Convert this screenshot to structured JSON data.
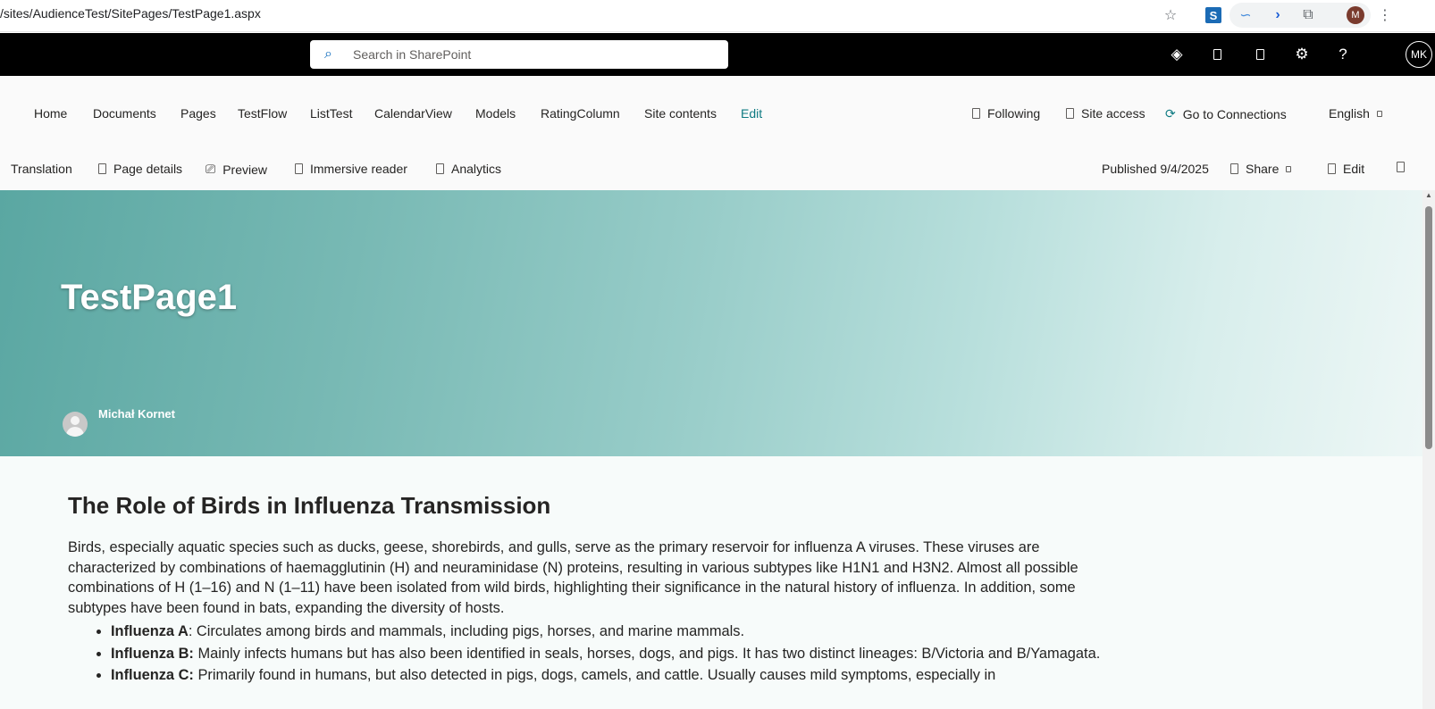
{
  "browser": {
    "url": "/sites/AudienceTest/SitePages/TestPage1.aspx",
    "profile_initial": "M",
    "extension_s": "S"
  },
  "suite": {
    "search_placeholder": "Search in SharePoint",
    "user_initials": "MK"
  },
  "site_nav": {
    "items": [
      "Home",
      "Documents",
      "Pages",
      "TestFlow",
      "ListTest",
      "CalendarView",
      "Models",
      "RatingColumn",
      "Site contents"
    ],
    "edit_label": "Edit",
    "following": "Following",
    "site_access": "Site access",
    "go_to_connections": "Go to Connections",
    "language": "English"
  },
  "command_bar": {
    "translation": "Translation",
    "page_details": "Page details",
    "preview": "Preview",
    "immersive_reader": "Immersive reader",
    "analytics": "Analytics",
    "published": "Published 9/4/2025",
    "share": "Share",
    "edit": "Edit"
  },
  "hero": {
    "title": "TestPage1",
    "author": "Michał Kornet"
  },
  "article": {
    "heading": "The Role of Birds in Influenza Transmission",
    "paragraph": "Birds, especially aquatic species such as ducks, geese, shorebirds, and gulls, serve as the primary reservoir for influenza A viruses. These viruses are characterized by combinations of haemagglutinin (H) and neuraminidase (N) proteins, resulting in various subtypes like H1N1 and H3N2. Almost all possible combinations of H (1–16) and N (1–11) have been isolated from wild birds, highlighting their significance in the natural history of influenza. In addition, some subtypes have been found in bats, expanding the diversity of hosts.",
    "bullets": [
      {
        "term": "Influenza A",
        "text": ": Circulates among birds and mammals, including pigs, horses, and marine mammals."
      },
      {
        "term": "Influenza B:",
        "text": " Mainly infects humans but has also been identified in seals, horses, dogs, and pigs. It has two distinct lineages: B/Victoria and B/Yamagata."
      },
      {
        "term": "Influenza C:",
        "text": " Primarily found in humans, but also detected in pigs, dogs, camels, and cattle. Usually causes mild symptoms, especially in"
      }
    ]
  }
}
